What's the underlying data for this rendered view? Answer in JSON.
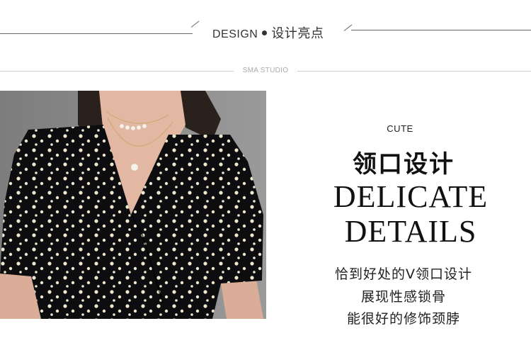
{
  "header": {
    "title_en": "DESIGN",
    "title_cn": "设计亮点",
    "studio": "SMA STUDIO"
  },
  "feature": {
    "tag": "CUTE",
    "title_cn": "领口设计",
    "title_en_line1": "DELICATE",
    "title_en_line2": "DETAILS",
    "desc_line1": "恰到好处的V领口设计",
    "desc_line2": "展现性感锁骨",
    "desc_line3": "能很好的修饰颈脖"
  }
}
